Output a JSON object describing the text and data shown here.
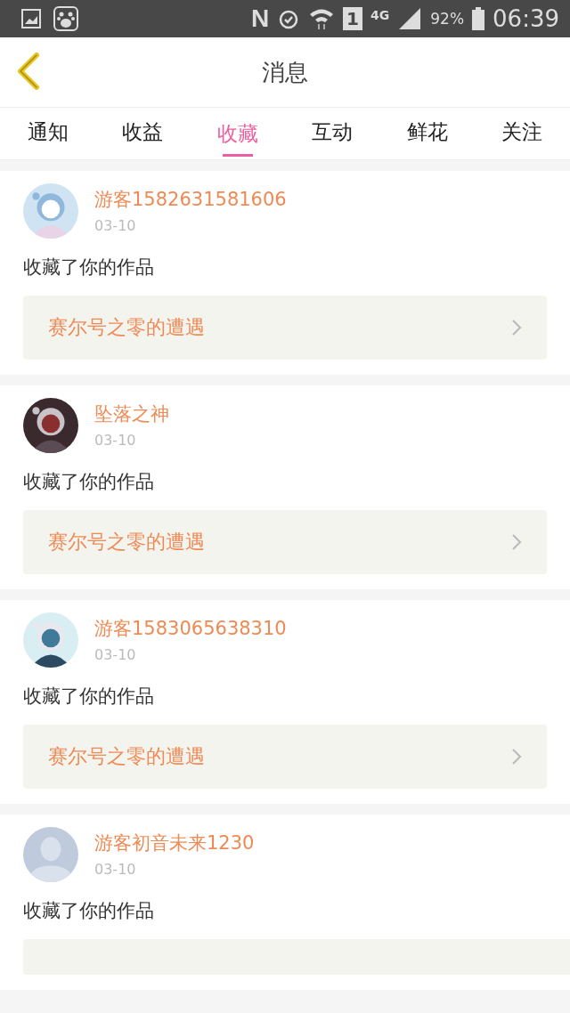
{
  "status_bar": {
    "nfc": "N",
    "sim": "1",
    "network": "4G",
    "battery": "92%",
    "time": "06:39"
  },
  "header": {
    "title": "消息"
  },
  "tabs": [
    {
      "label": "通知",
      "selected": false
    },
    {
      "label": "收益",
      "selected": false
    },
    {
      "label": "收藏",
      "selected": true
    },
    {
      "label": "互动",
      "selected": false
    },
    {
      "label": "鲜花",
      "selected": false
    },
    {
      "label": "关注",
      "selected": false
    }
  ],
  "messages": [
    {
      "name": "游客1582631581606",
      "date": "03-10",
      "text": "收藏了你的作品",
      "work": {
        "kind": "full",
        "title": "赛尔号之零的遭遇"
      }
    },
    {
      "name": "坠落之神",
      "date": "03-10",
      "text": "收藏了你的作品",
      "work": {
        "kind": "full",
        "title": "赛尔号之零的遭遇"
      }
    },
    {
      "name": "游客1583065638310",
      "date": "03-10",
      "text": "收藏了你的作品",
      "work": {
        "kind": "full",
        "title": "赛尔号之零的遭遇"
      }
    },
    {
      "avatar": {
        "kind": "default"
      },
      "name": "游客初音未来1230",
      "date": "03-10",
      "text": "收藏了你的作品",
      "work": {
        "kind": "partial"
      }
    }
  ]
}
